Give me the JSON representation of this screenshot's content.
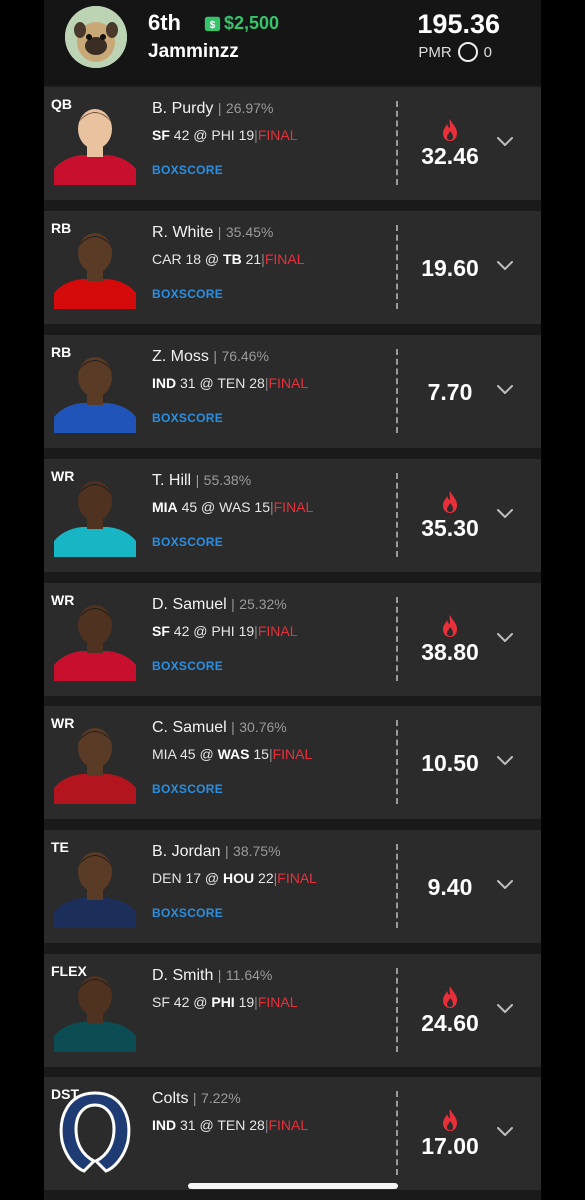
{
  "header": {
    "rank": "6th",
    "prize": "$2,500",
    "prize_icon": "moneybag-icon",
    "username": "Jamminzz",
    "total_points": "195.36",
    "pmr_label": "PMR",
    "pmr_value": "0"
  },
  "colors": {
    "card_bg": "#2b2b2b",
    "prize_green": "#35c46a",
    "final_red": "#e8303b",
    "boxscore_blue": "#2a8fe0",
    "flame_red": "#e8303b"
  },
  "players": [
    {
      "pos": "QB",
      "name": "B. Purdy",
      "own": "26.97%",
      "team": "SF",
      "team_score": "42",
      "at": "@",
      "opp": "PHI",
      "opp_score": "19",
      "status": "FINAL",
      "boxscore": "BOXSCORE",
      "points": "32.46",
      "hot": true
    },
    {
      "pos": "RB",
      "name": "R. White",
      "own": "35.45%",
      "team": "CAR",
      "team_score": "18",
      "at": "@",
      "opp": "TB",
      "opp_score": "21",
      "status": "FINAL",
      "boxscore": "BOXSCORE",
      "points": "19.60",
      "hot": false
    },
    {
      "pos": "RB",
      "name": "Z. Moss",
      "own": "76.46%",
      "team": "IND",
      "team_score": "31",
      "at": "@",
      "opp": "TEN",
      "opp_score": "28",
      "status": "FINAL",
      "boxscore": "BOXSCORE",
      "points": "7.70",
      "hot": false
    },
    {
      "pos": "WR",
      "name": "T. Hill",
      "own": "55.38%",
      "team": "MIA",
      "team_score": "45",
      "at": "@",
      "opp": "WAS",
      "opp_score": "15",
      "status": "FINAL",
      "boxscore": "BOXSCORE",
      "points": "35.30",
      "hot": true
    },
    {
      "pos": "WR",
      "name": "D. Samuel",
      "own": "25.32%",
      "team": "SF",
      "team_score": "42",
      "at": "@",
      "opp": "PHI",
      "opp_score": "19",
      "status": "FINAL",
      "boxscore": "BOXSCORE",
      "points": "38.80",
      "hot": true
    },
    {
      "pos": "WR",
      "name": "C. Samuel",
      "own": "30.76%",
      "team": "MIA",
      "team_score": "45",
      "at": "@",
      "opp": "WAS",
      "opp_score": "15",
      "status": "FINAL",
      "boxscore": "BOXSCORE",
      "points": "10.50",
      "hot": false
    },
    {
      "pos": "TE",
      "name": "B. Jordan",
      "own": "38.75%",
      "team": "DEN",
      "team_score": "17",
      "at": "@",
      "opp": "HOU",
      "opp_score": "22",
      "status": "FINAL",
      "boxscore": "BOXSCORE",
      "points": "9.40",
      "hot": false
    },
    {
      "pos": "FLEX",
      "name": "D. Smith",
      "own": "11.64%",
      "team": "SF",
      "team_score": "42",
      "at": "@",
      "opp": "PHI",
      "opp_score": "19",
      "status": "FINAL",
      "boxscore": "",
      "points": "24.60",
      "hot": true
    },
    {
      "pos": "DST",
      "name": "Colts",
      "own": "7.22%",
      "team": "IND",
      "team_score": "31",
      "at": "@",
      "opp": "TEN",
      "opp_score": "28",
      "status": "FINAL",
      "boxscore": "",
      "points": "17.00",
      "hot": true
    }
  ]
}
